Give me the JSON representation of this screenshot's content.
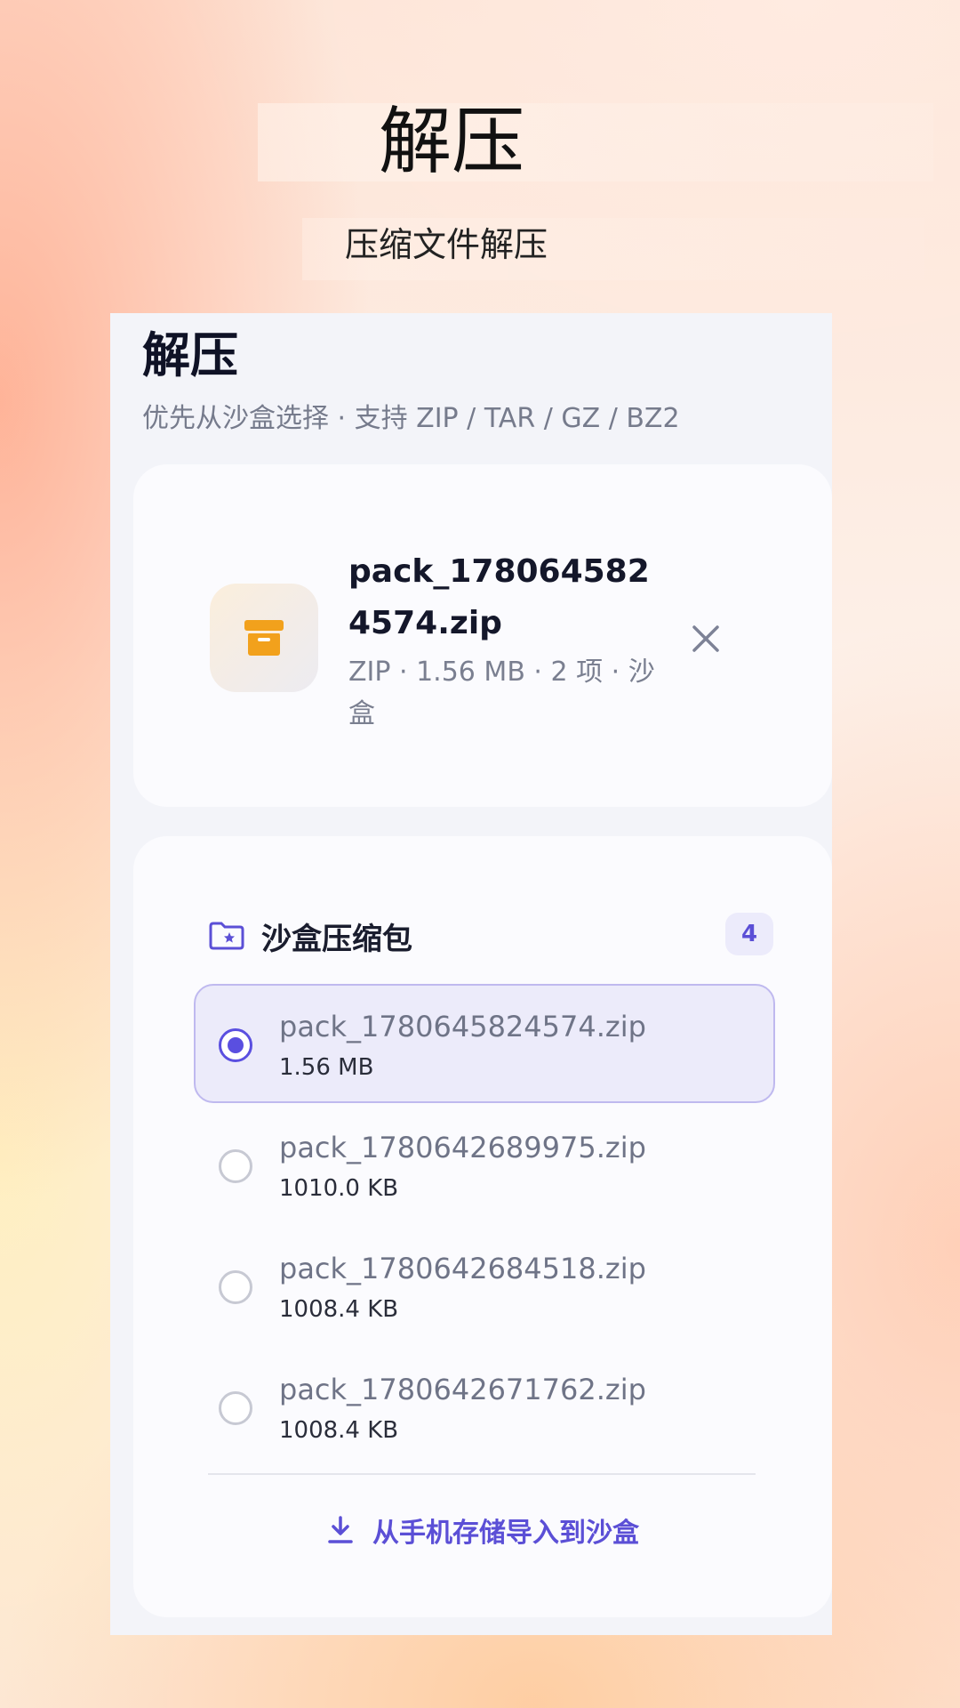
{
  "hero": {
    "title": "解压",
    "subtitle": "压缩文件解压"
  },
  "screen": {
    "title": "解压",
    "subtitle": "优先从沙盒选择 · 支持 ZIP / TAR / GZ / BZ2"
  },
  "selected_file": {
    "name": "pack_1780645824574.zip",
    "meta": "ZIP · 1.56 MB · 2 项 · 沙盒",
    "icon": "archive-box-icon"
  },
  "sandbox": {
    "title": "沙盒压缩包",
    "count": "4",
    "items": [
      {
        "name": "pack_1780645824574.zip",
        "size": "1.56 MB",
        "selected": true
      },
      {
        "name": "pack_1780642689975.zip",
        "size": "1010.0 KB",
        "selected": false
      },
      {
        "name": "pack_1780642684518.zip",
        "size": "1008.4 KB",
        "selected": false
      },
      {
        "name": "pack_1780642671762.zip",
        "size": "1008.4 KB",
        "selected": false
      }
    ],
    "import_label": "从手机存储导入到沙盒"
  },
  "colors": {
    "accent": "#5a4fe0",
    "archive_icon": "#f2a11c"
  }
}
